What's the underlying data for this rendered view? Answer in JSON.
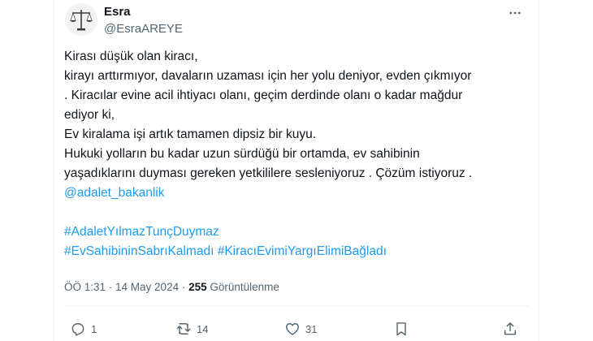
{
  "user": {
    "display_name": "Esra",
    "handle": "@EsraAREYE"
  },
  "tweet": {
    "lines": [
      "Kirası düşük olan kiracı,",
      "kirayı arttırmıyor, davaların uzaması için her yolu deniyor, evden çıkmıyor",
      ". Kiracılar evine acil ihtiyacı olanı, geçim derdinde olanı o kadar mağdur",
      "ediyor ki,",
      "Ev kiralama işi artık tamamen dipsiz bir kuyu.",
      "Hukuki yolların bu kadar uzun sürdüğü bir ortamda, ev sahibinin",
      "yaşadıklarını duyması gereken yetkililere sesleniyoruz . Çözüm istiyoruz ."
    ],
    "mention": "@adalet_bakanlik",
    "hashtags": [
      "#AdaletYılmazTunçDuymaz",
      "#EvSahibininSabrıKalmadı",
      "#KiracıEvimiYargıElimiBağladı"
    ]
  },
  "meta": {
    "time": "ÖÖ 1:31",
    "separator": " · ",
    "date": "14 May 2024",
    "views_count": "255",
    "views_label": "Görüntülenme"
  },
  "actions": {
    "reply_count": "1",
    "retweet_count": "14",
    "like_count": "31"
  },
  "icons": {
    "more": "more-horizontal-icon",
    "reply": "reply-icon",
    "retweet": "retweet-icon",
    "like": "heart-icon",
    "bookmark": "bookmark-icon",
    "share": "share-icon"
  },
  "colors": {
    "link": "#1d9bf0",
    "secondary_text": "#536471",
    "primary_text": "#0f1419"
  }
}
